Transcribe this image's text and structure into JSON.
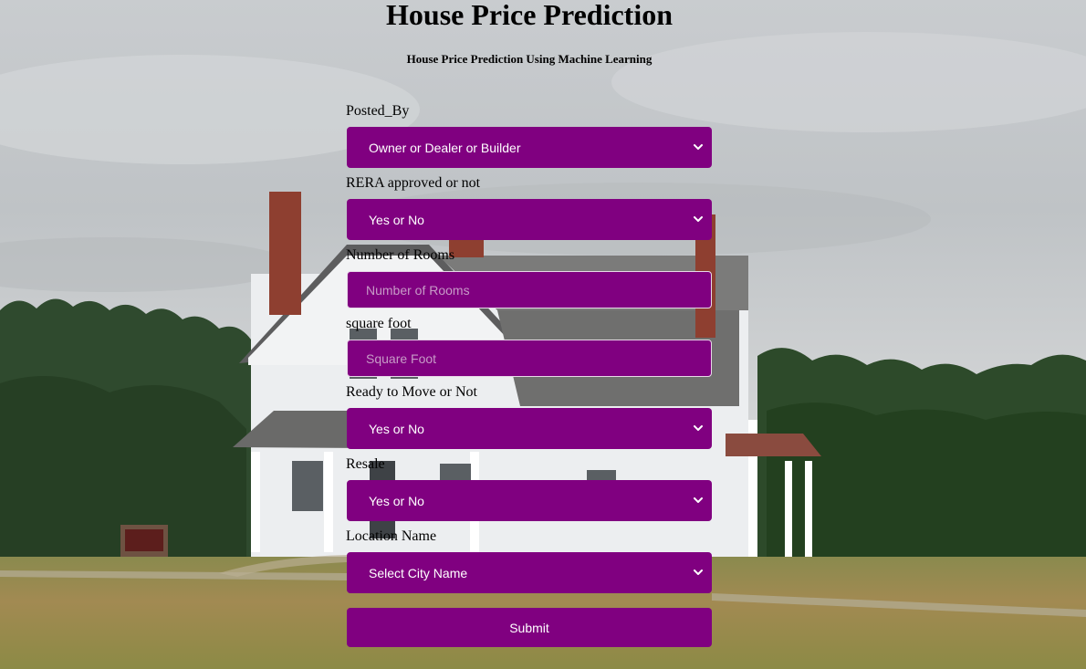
{
  "page": {
    "title": "House Price Prediction",
    "subtitle": "House Price Prediction Using Machine Learning"
  },
  "form": {
    "fields": [
      {
        "label": "Posted_By",
        "type": "select",
        "value": "Owner or Dealer or Builder"
      },
      {
        "label": "RERA approved or not",
        "type": "select",
        "value": "Yes or No"
      },
      {
        "label": "Number of Rooms",
        "type": "input",
        "placeholder": "Number of Rooms"
      },
      {
        "label": "square foot",
        "type": "input",
        "placeholder": "Square Foot"
      },
      {
        "label": "Ready to Move or Not",
        "type": "select",
        "value": "Yes or No"
      },
      {
        "label": "Resale",
        "type": "select",
        "value": "Yes or No"
      },
      {
        "label": "Location Name",
        "type": "select",
        "value": "Select City Name"
      }
    ],
    "submit_label": "Submit"
  },
  "colors": {
    "control_background": "#800080",
    "control_text": "#ffffff",
    "placeholder_text": "#c79bc7"
  },
  "icons": {
    "select_arrow": "chevron-down-icon"
  },
  "background": {
    "description_icon": "house-photo"
  }
}
